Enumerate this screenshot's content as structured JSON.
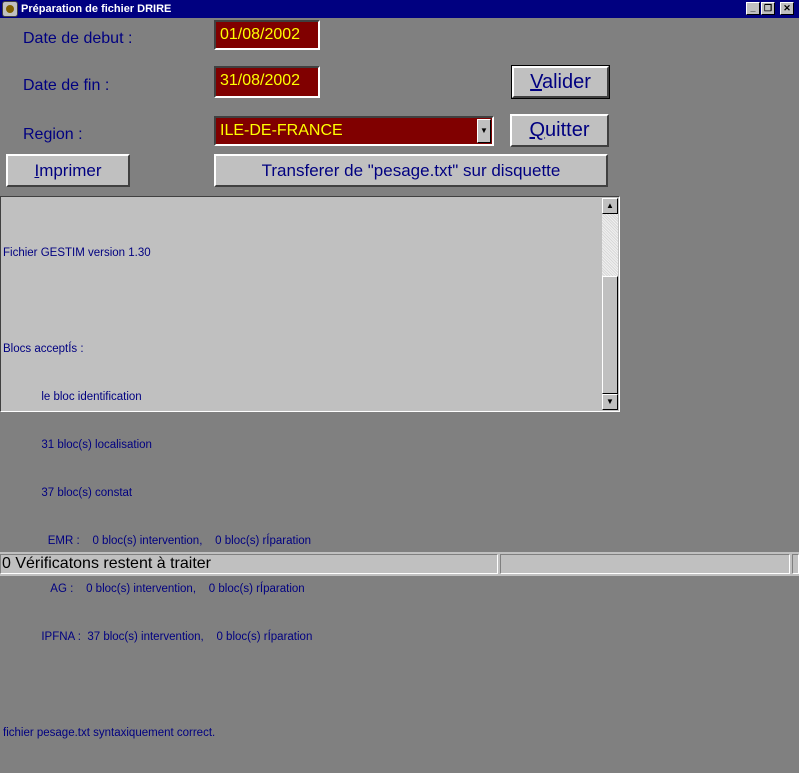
{
  "window": {
    "title": "Préparation de fichier DRIRE",
    "minimize_glyph": "_",
    "restore_glyph": "❐",
    "close_glyph": "✕"
  },
  "form": {
    "start_label": "Date de debut :",
    "start_value": "01/08/2002",
    "end_label": "Date de fin :",
    "end_value": "31/08/2002",
    "region_label": "Region :",
    "region_value": "ILE-DE-FRANCE",
    "dropdown_glyph": "▼"
  },
  "buttons": {
    "validate": {
      "accel": "V",
      "rest": "alider"
    },
    "quit": {
      "accel": "Q",
      "rest": "uitter"
    },
    "print": {
      "accel": "I",
      "rest": "mprimer"
    },
    "transfer": "Transferer de \"pesage.txt\" sur disquette"
  },
  "log": {
    "lines": [
      "Fichier GESTIM version 1.30",
      "",
      "Blocs acceptÍs :",
      "            le bloc identification",
      "            31 bloc(s) localisation",
      "            37 bloc(s) constat",
      "              EMR :    0 bloc(s) intervention,    0 bloc(s) rÍparation",
      "               AG :    0 bloc(s) intervention,    0 bloc(s) rÍparation",
      "            IPFNA :  37 bloc(s) intervention,    0 bloc(s) rÍparation",
      "",
      "fichier pesage.txt syntaxiquement correct."
    ],
    "scroll_up_glyph": "▲",
    "scroll_down_glyph": "▼"
  },
  "status": {
    "message": "0 Vérificatons restent à traiter",
    "pane2": "",
    "pane3": ""
  },
  "colors": {
    "field_bg": "#800000",
    "field_text": "#ffff00",
    "label_text": "#000080",
    "titlebar": "#000080"
  }
}
